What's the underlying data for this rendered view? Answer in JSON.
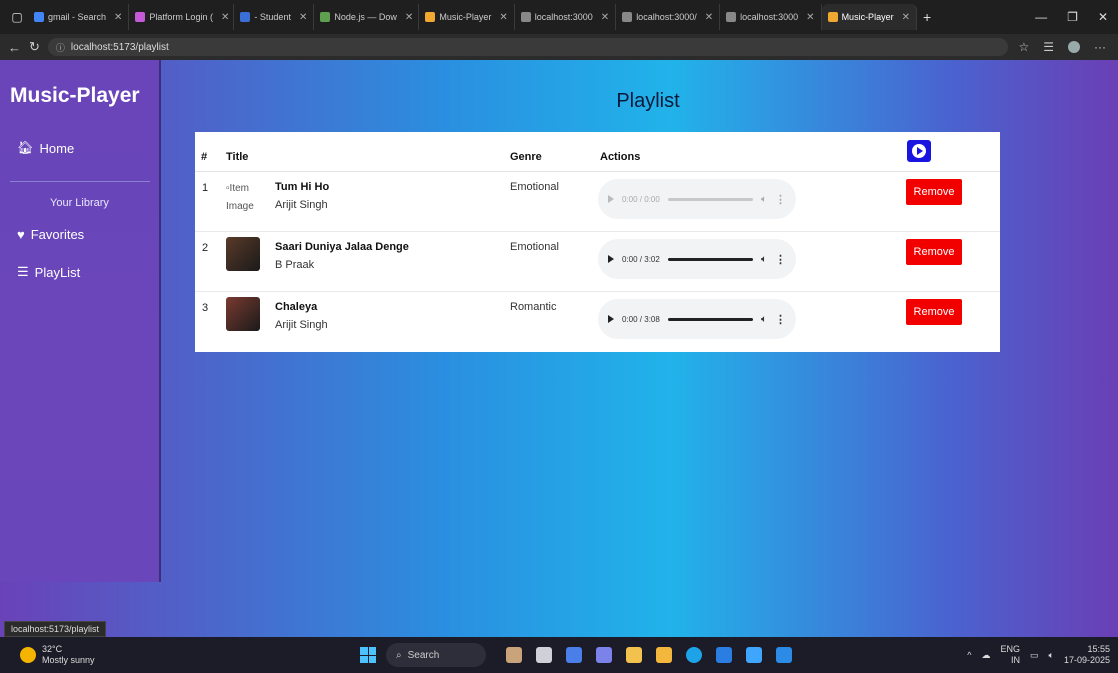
{
  "browser": {
    "tabs": [
      {
        "label": "gmail - Search",
        "color": "#4285f4"
      },
      {
        "label": "Platform Login (",
        "color": "#c45ad8"
      },
      {
        "label": "- Student",
        "color": "#3b6fd8"
      },
      {
        "label": "Node.js — Dow",
        "color": "#5fa04e"
      },
      {
        "label": "Music-Player",
        "color": "#f0a830"
      },
      {
        "label": "localhost:3000",
        "color": "#888888"
      },
      {
        "label": "localhost:3000/",
        "color": "#888888"
      },
      {
        "label": "localhost:3000",
        "color": "#888888"
      },
      {
        "label": "Music-Player",
        "color": "#f0a830"
      }
    ],
    "url": "localhost:5173/playlist",
    "status_url": "localhost:5173/playlist"
  },
  "sidebar": {
    "brand": "Music-Player",
    "home": "Home",
    "library_title": "Your Library",
    "favorites": "Favorites",
    "playlist": "PlayList"
  },
  "page": {
    "title": "Playlist",
    "columns": {
      "num": "#",
      "title": "Title",
      "genre": "Genre",
      "actions": "Actions"
    },
    "remove_label": "Remove",
    "rows": [
      {
        "num": "1",
        "title": "Tum Hi Ho",
        "artist": "Arijit Singh",
        "genre": "Emotional",
        "time": "0:00 / 0:00",
        "progress": 0,
        "image_alt": "Item Image",
        "thumb_color": null
      },
      {
        "num": "2",
        "title": "Saari Duniya Jalaa Denge",
        "artist": "B Praak",
        "genre": "Emotional",
        "time": "0:00 / 3:02",
        "progress": 0,
        "image_alt": "",
        "thumb_color": "#5a3a28"
      },
      {
        "num": "3",
        "title": "Chaleya",
        "artist": "Arijit Singh",
        "genre": "Romantic",
        "time": "0:00 / 3:08",
        "progress": 0,
        "image_alt": "",
        "thumb_color": "#7a3a30"
      }
    ]
  },
  "taskbar": {
    "weather_temp": "32°C",
    "weather_desc": "Mostly sunny",
    "search": "Search",
    "lang1": "ENG",
    "lang2": "IN",
    "time": "15:55",
    "date": "17-09-2025"
  }
}
